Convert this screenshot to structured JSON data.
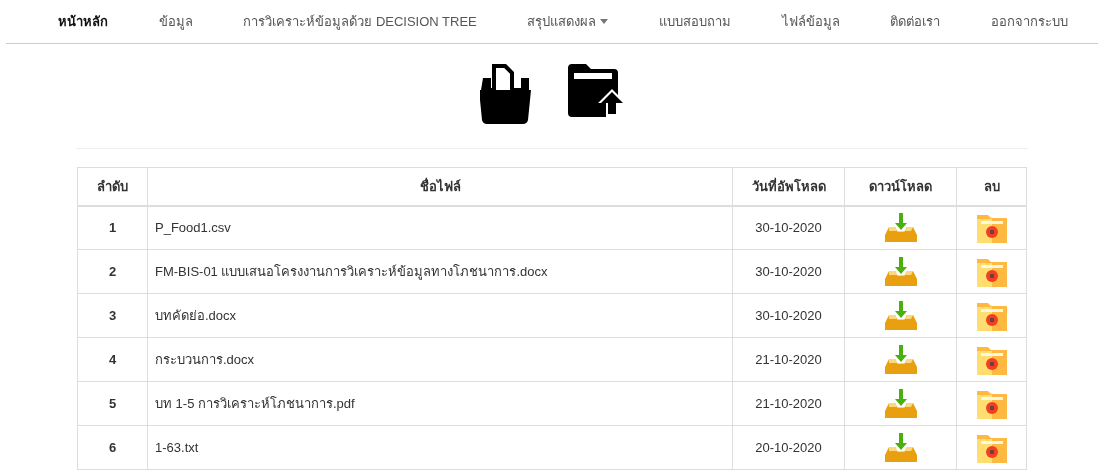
{
  "nav": [
    {
      "label": "หน้าหลัก",
      "selected": true,
      "kind": "link"
    },
    {
      "label": "ข้อมูล",
      "selected": false,
      "kind": "link"
    },
    {
      "label": "การวิเคราะห์ข้อมูลด้วย DECISION TREE",
      "selected": false,
      "kind": "link"
    },
    {
      "label": "สรุปแสดงผล",
      "selected": false,
      "kind": "dropdown"
    },
    {
      "label": "แบบสอบถาม",
      "selected": false,
      "kind": "link"
    },
    {
      "label": "ไฟล์ข้อมูล",
      "selected": false,
      "kind": "link"
    },
    {
      "label": "ติดต่อเรา",
      "selected": false,
      "kind": "link"
    },
    {
      "label": "ออกจากระบบ",
      "selected": false,
      "kind": "link"
    }
  ],
  "table": {
    "columns": [
      "ลำดับ",
      "ชื่อไฟล์",
      "วันที่อัพโหลด",
      "ดาวน์โหลด",
      "ลบ"
    ],
    "rows": [
      {
        "no": "1",
        "name": "P_Food1.csv",
        "date": "30-10-2020"
      },
      {
        "no": "2",
        "name": "FM-BIS-01 แบบเสนอโครงงานการวิเคราะห์ข้อมูลทางโภชนาการ.docx",
        "date": "30-10-2020"
      },
      {
        "no": "3",
        "name": "บทคัดย่อ.docx",
        "date": "30-10-2020"
      },
      {
        "no": "4",
        "name": "กระบวนการ.docx",
        "date": "21-10-2020"
      },
      {
        "no": "5",
        "name": "บท 1-5 การวิเคราะห์โภชนาการ.pdf",
        "date": "21-10-2020"
      },
      {
        "no": "6",
        "name": "1-63.txt",
        "date": "20-10-2020"
      }
    ]
  }
}
